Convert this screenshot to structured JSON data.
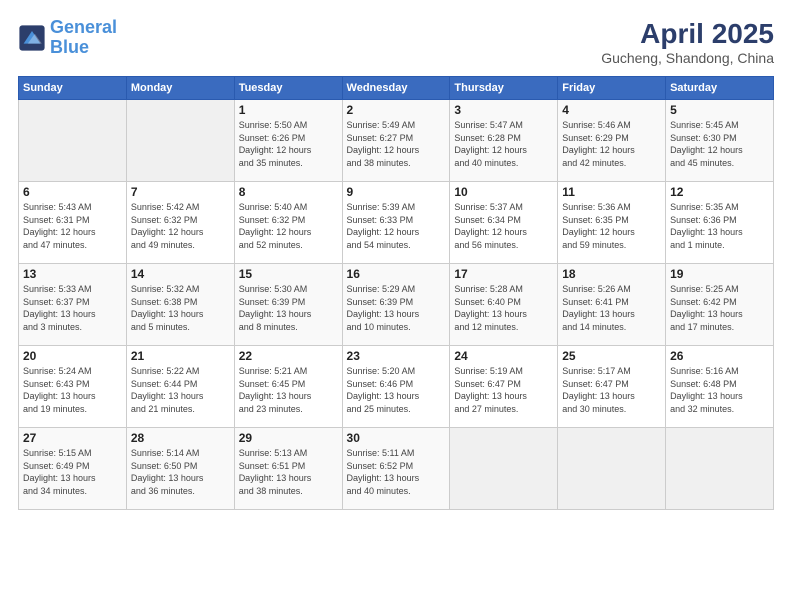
{
  "header": {
    "logo_line1": "General",
    "logo_line2": "Blue",
    "title": "April 2025",
    "subtitle": "Gucheng, Shandong, China"
  },
  "days_of_week": [
    "Sunday",
    "Monday",
    "Tuesday",
    "Wednesday",
    "Thursday",
    "Friday",
    "Saturday"
  ],
  "weeks": [
    [
      {
        "day": "",
        "info": ""
      },
      {
        "day": "",
        "info": ""
      },
      {
        "day": "1",
        "info": "Sunrise: 5:50 AM\nSunset: 6:26 PM\nDaylight: 12 hours\nand 35 minutes."
      },
      {
        "day": "2",
        "info": "Sunrise: 5:49 AM\nSunset: 6:27 PM\nDaylight: 12 hours\nand 38 minutes."
      },
      {
        "day": "3",
        "info": "Sunrise: 5:47 AM\nSunset: 6:28 PM\nDaylight: 12 hours\nand 40 minutes."
      },
      {
        "day": "4",
        "info": "Sunrise: 5:46 AM\nSunset: 6:29 PM\nDaylight: 12 hours\nand 42 minutes."
      },
      {
        "day": "5",
        "info": "Sunrise: 5:45 AM\nSunset: 6:30 PM\nDaylight: 12 hours\nand 45 minutes."
      }
    ],
    [
      {
        "day": "6",
        "info": "Sunrise: 5:43 AM\nSunset: 6:31 PM\nDaylight: 12 hours\nand 47 minutes."
      },
      {
        "day": "7",
        "info": "Sunrise: 5:42 AM\nSunset: 6:32 PM\nDaylight: 12 hours\nand 49 minutes."
      },
      {
        "day": "8",
        "info": "Sunrise: 5:40 AM\nSunset: 6:32 PM\nDaylight: 12 hours\nand 52 minutes."
      },
      {
        "day": "9",
        "info": "Sunrise: 5:39 AM\nSunset: 6:33 PM\nDaylight: 12 hours\nand 54 minutes."
      },
      {
        "day": "10",
        "info": "Sunrise: 5:37 AM\nSunset: 6:34 PM\nDaylight: 12 hours\nand 56 minutes."
      },
      {
        "day": "11",
        "info": "Sunrise: 5:36 AM\nSunset: 6:35 PM\nDaylight: 12 hours\nand 59 minutes."
      },
      {
        "day": "12",
        "info": "Sunrise: 5:35 AM\nSunset: 6:36 PM\nDaylight: 13 hours\nand 1 minute."
      }
    ],
    [
      {
        "day": "13",
        "info": "Sunrise: 5:33 AM\nSunset: 6:37 PM\nDaylight: 13 hours\nand 3 minutes."
      },
      {
        "day": "14",
        "info": "Sunrise: 5:32 AM\nSunset: 6:38 PM\nDaylight: 13 hours\nand 5 minutes."
      },
      {
        "day": "15",
        "info": "Sunrise: 5:30 AM\nSunset: 6:39 PM\nDaylight: 13 hours\nand 8 minutes."
      },
      {
        "day": "16",
        "info": "Sunrise: 5:29 AM\nSunset: 6:39 PM\nDaylight: 13 hours\nand 10 minutes."
      },
      {
        "day": "17",
        "info": "Sunrise: 5:28 AM\nSunset: 6:40 PM\nDaylight: 13 hours\nand 12 minutes."
      },
      {
        "day": "18",
        "info": "Sunrise: 5:26 AM\nSunset: 6:41 PM\nDaylight: 13 hours\nand 14 minutes."
      },
      {
        "day": "19",
        "info": "Sunrise: 5:25 AM\nSunset: 6:42 PM\nDaylight: 13 hours\nand 17 minutes."
      }
    ],
    [
      {
        "day": "20",
        "info": "Sunrise: 5:24 AM\nSunset: 6:43 PM\nDaylight: 13 hours\nand 19 minutes."
      },
      {
        "day": "21",
        "info": "Sunrise: 5:22 AM\nSunset: 6:44 PM\nDaylight: 13 hours\nand 21 minutes."
      },
      {
        "day": "22",
        "info": "Sunrise: 5:21 AM\nSunset: 6:45 PM\nDaylight: 13 hours\nand 23 minutes."
      },
      {
        "day": "23",
        "info": "Sunrise: 5:20 AM\nSunset: 6:46 PM\nDaylight: 13 hours\nand 25 minutes."
      },
      {
        "day": "24",
        "info": "Sunrise: 5:19 AM\nSunset: 6:47 PM\nDaylight: 13 hours\nand 27 minutes."
      },
      {
        "day": "25",
        "info": "Sunrise: 5:17 AM\nSunset: 6:47 PM\nDaylight: 13 hours\nand 30 minutes."
      },
      {
        "day": "26",
        "info": "Sunrise: 5:16 AM\nSunset: 6:48 PM\nDaylight: 13 hours\nand 32 minutes."
      }
    ],
    [
      {
        "day": "27",
        "info": "Sunrise: 5:15 AM\nSunset: 6:49 PM\nDaylight: 13 hours\nand 34 minutes."
      },
      {
        "day": "28",
        "info": "Sunrise: 5:14 AM\nSunset: 6:50 PM\nDaylight: 13 hours\nand 36 minutes."
      },
      {
        "day": "29",
        "info": "Sunrise: 5:13 AM\nSunset: 6:51 PM\nDaylight: 13 hours\nand 38 minutes."
      },
      {
        "day": "30",
        "info": "Sunrise: 5:11 AM\nSunset: 6:52 PM\nDaylight: 13 hours\nand 40 minutes."
      },
      {
        "day": "",
        "info": ""
      },
      {
        "day": "",
        "info": ""
      },
      {
        "day": "",
        "info": ""
      }
    ]
  ]
}
